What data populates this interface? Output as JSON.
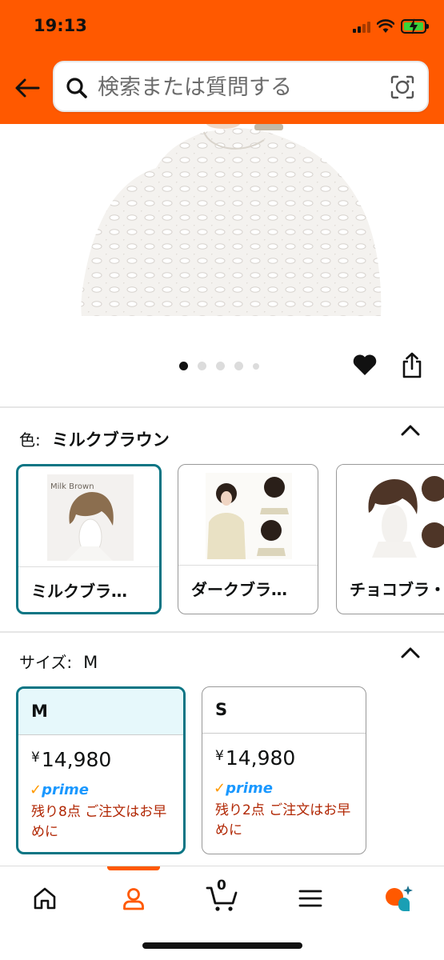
{
  "status_bar": {
    "time": "19:13"
  },
  "search": {
    "placeholder": "検索または質問する"
  },
  "icons": {
    "back": "back-arrow-icon",
    "search": "search-icon",
    "camera": "camera-lens-icon",
    "heart": "heart-icon",
    "share": "share-icon"
  },
  "carousel": {
    "total": 5,
    "active_index": 0
  },
  "color": {
    "label": "色:",
    "selected": "ミルクブラウン",
    "options": [
      {
        "name": "ミルクブラ…",
        "thumb_text": "Milk Brown",
        "selected": true
      },
      {
        "name": "ダークブラ…",
        "selected": false
      },
      {
        "name": "チョコブラ・",
        "selected": false
      }
    ]
  },
  "size": {
    "label": "サイズ:",
    "selected": "M",
    "options": [
      {
        "name": "M",
        "yen": "¥",
        "price": "14,980",
        "prime": "prime",
        "stock": "残り8点 ご注文はお早めに",
        "selected": true
      },
      {
        "name": "S",
        "yen": "¥",
        "price": "14,980",
        "prime": "prime",
        "stock": "残り2点 ご注文はお早めに",
        "selected": false
      }
    ]
  },
  "bottom_nav": {
    "items": [
      "home-icon",
      "account-icon",
      "cart-icon",
      "menu-icon",
      "rufus-icon"
    ],
    "active": "account-icon",
    "cart_count": "0"
  },
  "colors": {
    "brand": "#ff5900",
    "selected_border": "#0a7584",
    "stock_text": "#b12704",
    "prime_blue": "#1a98ff"
  }
}
